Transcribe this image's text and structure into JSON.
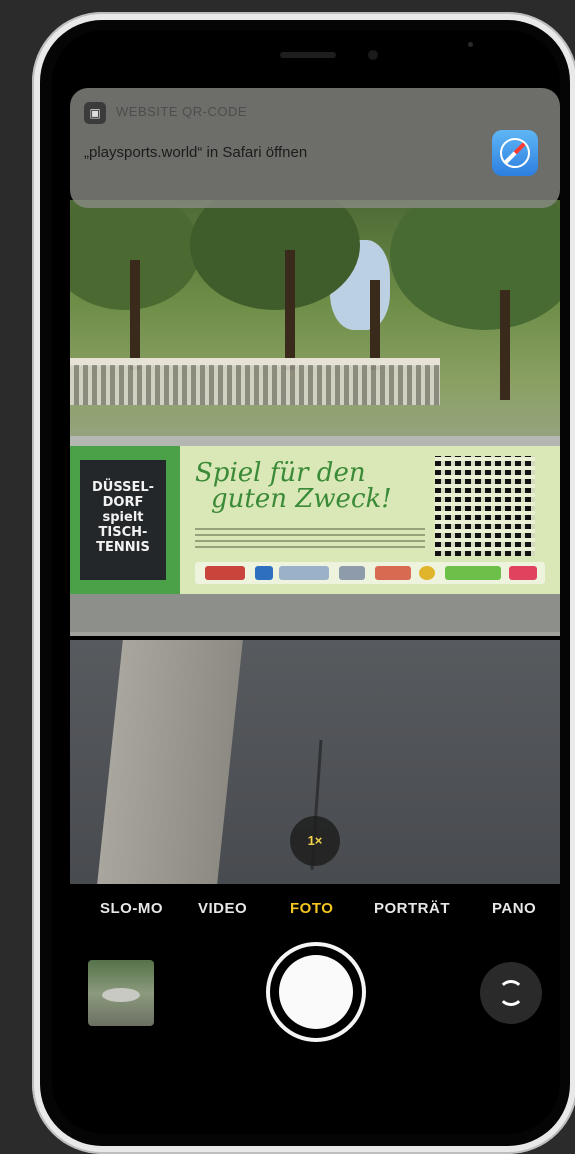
{
  "notification": {
    "app_name": "WEBSITE QR-CODE",
    "message": "„playsports.world“ in Safari öffnen",
    "safari_icon": "safari-icon"
  },
  "banner": {
    "chalkboard_lines": [
      "DÜSSEL-",
      "DORF",
      "spielt",
      "TISCH-",
      "TENNIS"
    ],
    "slogan_line1": "Spiel für den",
    "slogan_line2": "guten Zweck!"
  },
  "zoom": {
    "label": "1×"
  },
  "modes": {
    "items": [
      "SLO-MO",
      "VIDEO",
      "FOTO",
      "PORTRÄT",
      "PANO"
    ],
    "active": "FOTO"
  },
  "colors": {
    "active_mode": "#f3c623",
    "banner_green": "#4aa147",
    "safari_blue": "#2d7fe0"
  }
}
